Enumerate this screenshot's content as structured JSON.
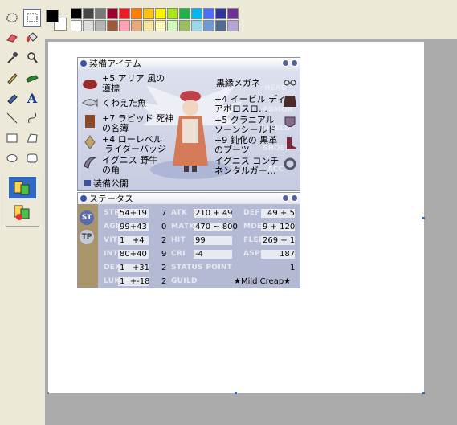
{
  "toolbox": {
    "tools": [
      "free-form-select",
      "rect-select",
      "eraser",
      "fill",
      "color-picker",
      "magnifier",
      "pencil",
      "brush",
      "airbrush",
      "text",
      "line",
      "curve",
      "rectangle",
      "polygon",
      "ellipse",
      "rounded-rectangle"
    ],
    "text_tool_glyph": "A"
  },
  "palette": {
    "foreground": "#000000",
    "background": "#ffffff",
    "row1": [
      "#000000",
      "#464646",
      "#787878",
      "#990030",
      "#ed1c24",
      "#ff7e00",
      "#ffc20e",
      "#fff200",
      "#a8e61d",
      "#22b14c",
      "#00b7ef",
      "#4d6df3",
      "#2f3699",
      "#6f3198"
    ],
    "row2": [
      "#ffffff",
      "#dcdcdc",
      "#b4b4b4",
      "#9c5a3c",
      "#ffa3b1",
      "#e5aa7a",
      "#f5e49c",
      "#fff9bd",
      "#d3f9bc",
      "#9dbb61",
      "#99d9ea",
      "#709ad1",
      "#546d8e",
      "#b5a5d5"
    ]
  },
  "equipment": {
    "title": "装備アイテム",
    "left": [
      "+5 アリア 風の\n道標",
      "くわえた魚",
      "+7 ラピッド 死神\nの名簿",
      "+4 ローレベル\n ライダーバッジ",
      "イグニス 野牛\nの角"
    ],
    "right": [
      "黒縁メガネ",
      "+4 イービル ディ\nアボロスロ…",
      "+5 クラニアル\nソーンシールド",
      "+9 鈍化の 黒革\nのブーツ",
      "イグニス コンチ\nネンタルガー…"
    ],
    "ghost_labels": [
      "HEAD",
      "ARMOR",
      "SHIELD",
      "SHOES",
      "ACC"
    ],
    "public_label": "装備公開"
  },
  "status": {
    "title": "ステータス",
    "tabs": [
      "ST",
      "TP"
    ],
    "rows": [
      {
        "label": "STR",
        "val": "54+19",
        "pt": "7",
        "label2": "ATK",
        "val2": "210 + 49",
        "label3": "DEF",
        "val3": "49 + 5"
      },
      {
        "label": "AGI",
        "val": "99+43",
        "pt": "0",
        "label2": "MATK",
        "val2": "470 ~ 800",
        "label3": "MDEF",
        "val3": "9 + 120"
      },
      {
        "label": "VIT",
        "val": "1   +4",
        "pt": "2",
        "label2": "HIT",
        "val2": "99",
        "label3": "FLEE",
        "val3": "269 + 1"
      },
      {
        "label": "INT",
        "val": "80+40",
        "pt": "9",
        "label2": "CRI",
        "val2": "-4",
        "label3": "ASPD",
        "val3": "187"
      },
      {
        "label": "DEX",
        "val": "1   +31",
        "pt": "2",
        "label2": "STATUS POINT",
        "val2": "",
        "label3": "",
        "val3": "1"
      },
      {
        "label": "LUK",
        "val": "1  +-18",
        "pt": "2",
        "label2": "GUILD",
        "val2": "",
        "label3": "",
        "val3": "★Mild Creap★"
      }
    ]
  }
}
